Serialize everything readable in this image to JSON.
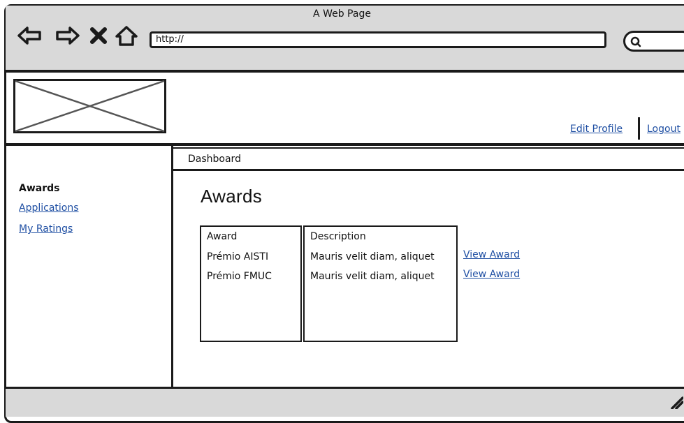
{
  "window": {
    "title": "A Web Page",
    "url": "http://"
  },
  "header": {
    "edit_profile": "Edit Profile",
    "logout": "Logout"
  },
  "sidebar": {
    "items": [
      {
        "label": "Awards",
        "current": true
      },
      {
        "label": "Applications",
        "current": false
      },
      {
        "label": "My Ratings",
        "current": false
      }
    ]
  },
  "breadcrumb": "Dashboard",
  "main": {
    "title": "Awards",
    "table": {
      "headers": [
        "Award",
        "Description"
      ],
      "rows": [
        {
          "award": "Prémio AISTI",
          "description": "Mauris velit diam, aliquet",
          "action": "View Award"
        },
        {
          "award": "Prémio FMUC",
          "description": "Mauris velit diam, aliquet",
          "action": "View Award"
        }
      ]
    }
  },
  "icons": [
    "back-arrow-icon",
    "forward-arrow-icon",
    "stop-icon",
    "home-icon",
    "search-icon",
    "image-placeholder-icon",
    "resize-grip-icon"
  ],
  "colors": {
    "chrome": "#d9d9d9",
    "link": "#1f4fa3",
    "stroke": "#1a1a1a"
  }
}
